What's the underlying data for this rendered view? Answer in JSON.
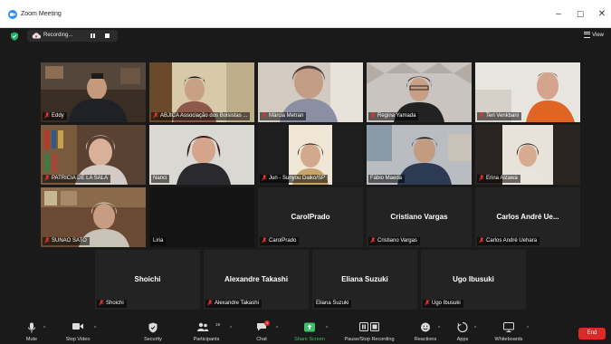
{
  "window": {
    "title": "Zoom Meeting",
    "minimize": "–",
    "maximize": "☐",
    "close": "✕"
  },
  "topbar": {
    "recording_label": "Recording...",
    "view_label": "View"
  },
  "participants": [
    {
      "name": "Eddy",
      "muted": true
    },
    {
      "name": "ABJICA Associação dos Bolsistas ...",
      "muted": true
    },
    {
      "name": "Márcia Metran",
      "muted": true
    },
    {
      "name": "Regina Yamada",
      "muted": true
    },
    {
      "name": "Teri Venkbani",
      "muted": true
    },
    {
      "name": "PATRICIA DE LA SALA",
      "muted": true
    },
    {
      "name": "Nanci",
      "muted": false
    },
    {
      "name": "Jun - Sunyou Daiko/SP",
      "muted": true
    },
    {
      "name": "Fábio Maeda",
      "muted": false
    },
    {
      "name": "Erina Aizawa",
      "muted": true
    },
    {
      "name": "SUNAO SATO",
      "muted": true
    },
    {
      "name": "Liria",
      "muted": false
    },
    {
      "name": "CarolPrado",
      "display": "CarolPrado",
      "muted": true
    },
    {
      "name": "Cristiano Vargas",
      "display": "Cristiano Vargas",
      "muted": true
    },
    {
      "name": "Carlos André Uehara",
      "display": "Carlos André Ue...",
      "muted": true
    },
    {
      "name": "Shoichi",
      "display": "Shoichi",
      "muted": true
    },
    {
      "name": "Alexandre Takashi",
      "display": "Alexandre Takashi",
      "muted": true
    },
    {
      "name": "Eliana Suzuki",
      "display": "Eliana Suzuki",
      "muted": false
    },
    {
      "name": "Ugo Ibusuki",
      "display": "Ugo Ibusuki",
      "muted": true
    }
  ],
  "toolbar": {
    "mute": "Mute",
    "stop_video": "Stop Video",
    "security": "Security",
    "participants": "Participants",
    "participants_count": "19",
    "chat": "Chat",
    "chat_badge": "1",
    "share_screen": "Share Screen",
    "pause_recording": "Pause/Stop Recording",
    "reactions": "Reactions",
    "apps": "Apps",
    "whiteboards": "Whiteboards",
    "end": "End"
  },
  "colors": {
    "speaking_outline": "#e6e33d",
    "share_green": "#3ec06a",
    "end_red": "#e02828",
    "mic_muted": "#e0362f"
  }
}
